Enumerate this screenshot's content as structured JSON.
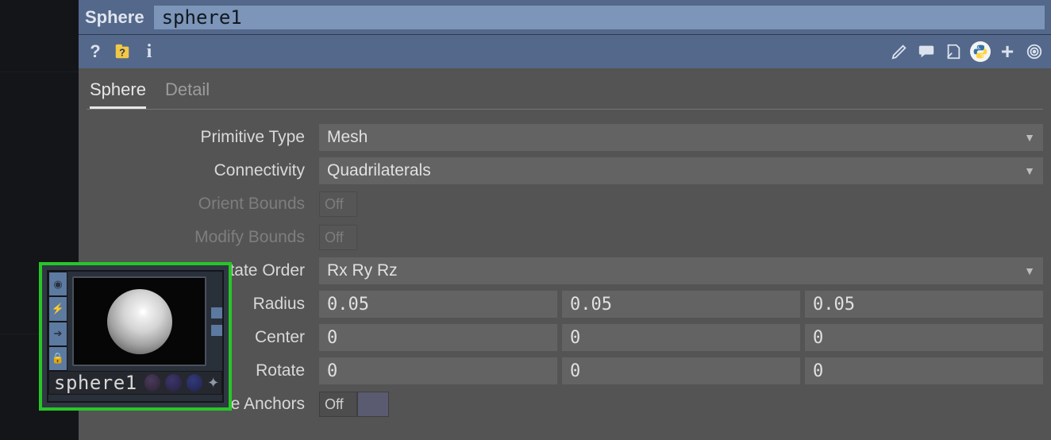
{
  "header": {
    "type_label": "Sphere",
    "name_value": "sphere1"
  },
  "tabs": [
    "Sphere",
    "Detail"
  ],
  "active_tab": 0,
  "node": {
    "label": "sphere1"
  },
  "params": {
    "primitive_type": {
      "label": "Primitive Type",
      "value": "Mesh"
    },
    "connectivity": {
      "label": "Connectivity",
      "value": "Quadrilaterals"
    },
    "orient_bounds": {
      "label": "Orient Bounds",
      "value": "Off",
      "disabled": true
    },
    "modify_bounds": {
      "label": "Modify Bounds",
      "value": "Off",
      "disabled": true
    },
    "rotate_order": {
      "label": "Rotate Order",
      "value": "Rx Ry Rz"
    },
    "radius": {
      "label": "Radius",
      "x": "0.05",
      "y": "0.05",
      "z": "0.05"
    },
    "center": {
      "label": "Center",
      "x": "0",
      "y": "0",
      "z": "0"
    },
    "rotate": {
      "label": "Rotate",
      "x": "0",
      "y": "0",
      "z": "0"
    },
    "reverse_anchors": {
      "label": "Reverse Anchors",
      "value": "Off"
    }
  },
  "icons": {
    "help": "?",
    "help_file": "?",
    "info": "i",
    "edit": "pencil",
    "comment": "speech",
    "note": "page",
    "python": "py",
    "plus": "+",
    "target": "◎"
  }
}
